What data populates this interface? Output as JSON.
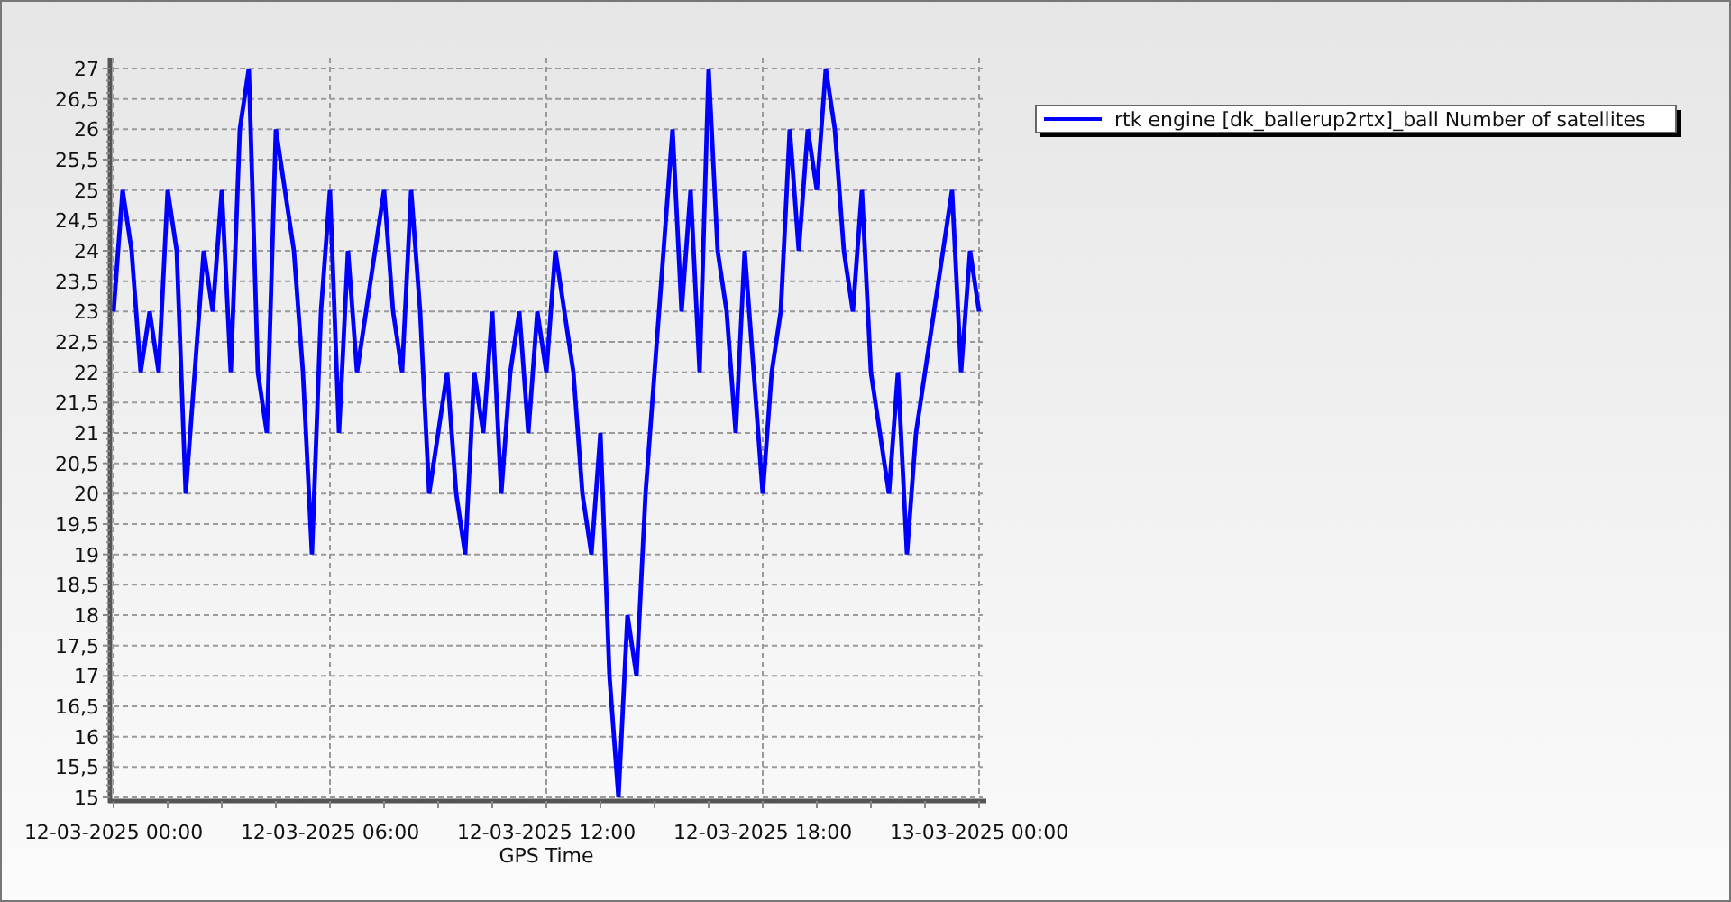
{
  "chart_data": {
    "type": "line",
    "xlabel": "GPS Time",
    "categories": [
      "12-03-2025 00:00",
      null,
      null,
      null,
      null,
      null,
      null,
      null,
      null,
      null,
      null,
      null,
      null,
      null,
      null,
      null,
      null,
      null,
      null,
      null,
      null,
      null,
      null,
      null,
      "12-03-2025 06:00",
      null,
      null,
      null,
      null,
      null,
      null,
      null,
      null,
      null,
      null,
      null,
      null,
      null,
      null,
      null,
      null,
      null,
      null,
      null,
      null,
      null,
      null,
      null,
      "12-03-2025 12:00",
      null,
      null,
      null,
      null,
      null,
      null,
      null,
      null,
      null,
      null,
      null,
      null,
      null,
      null,
      null,
      null,
      null,
      null,
      null,
      null,
      null,
      null,
      null,
      "12-03-2025 18:00",
      null,
      null,
      null,
      null,
      null,
      null,
      null,
      null,
      null,
      null,
      null,
      null,
      null,
      null,
      null,
      null,
      null,
      null,
      null,
      null,
      null,
      null,
      null,
      "13-03-2025 00:00"
    ],
    "series": [
      {
        "name": "rtk engine [dk_ballerup2rtx]_ball Number of satellites",
        "color": "#0000ff",
        "values": [
          23,
          25,
          24,
          22,
          23,
          22,
          25,
          24,
          20,
          22,
          24,
          23,
          25,
          22,
          26,
          27,
          22,
          21,
          26,
          25,
          24,
          22,
          19,
          23,
          25,
          21,
          24,
          22,
          23,
          24,
          25,
          23,
          22,
          25,
          23,
          20,
          21,
          22,
          20,
          19,
          22,
          21,
          23,
          20,
          22,
          23,
          21,
          23,
          22,
          24,
          23,
          22,
          20,
          19,
          21,
          17,
          15,
          18,
          17,
          20,
          22,
          24,
          26,
          23,
          25,
          22,
          27,
          24,
          23,
          21,
          24,
          22,
          20,
          22,
          23,
          26,
          24,
          26,
          25,
          27,
          26,
          24,
          23,
          25,
          22,
          21,
          20,
          22,
          19,
          21,
          22,
          23,
          24,
          25,
          22,
          24,
          23
        ]
      }
    ],
    "ylim": [
      15,
      27
    ],
    "grid": true,
    "yticks": [
      15,
      {
        "value": 15.5,
        "label": "15,5"
      },
      16,
      {
        "value": 16.5,
        "label": "16,5"
      },
      17,
      {
        "value": 17.5,
        "label": "17,5"
      },
      18,
      {
        "value": 18.5,
        "label": "18,5"
      },
      19,
      {
        "value": 19.5,
        "label": "19,5"
      },
      20,
      {
        "value": 20.5,
        "label": "20,5"
      },
      21,
      {
        "value": 21.5,
        "label": "21,5"
      },
      22,
      {
        "value": 22.5,
        "label": "22,5"
      },
      23,
      {
        "value": 23.5,
        "label": "23,5"
      },
      24,
      {
        "value": 24.5,
        "label": "24,5"
      },
      25,
      {
        "value": 25.5,
        "label": "25,5"
      },
      26,
      {
        "value": 26.5,
        "label": "26,5"
      },
      27
    ]
  }
}
